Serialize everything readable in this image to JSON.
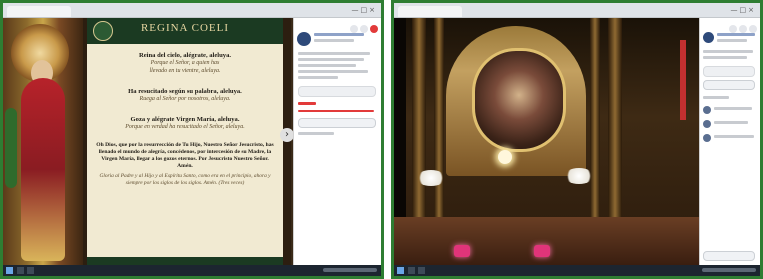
{
  "left_screen": {
    "title": "REGINA COELI",
    "verses": [
      {
        "bold": "Reina del cielo, alégrate, aleluya.",
        "italic": "Porque el Señor, a quien has\nllevado en tu vientre, aleluya."
      },
      {
        "bold": "Ha resucitado según su palabra, aleluya.",
        "italic": "Ruega al Señor por nosotros, aleluya."
      },
      {
        "bold": "Goza y alégrate Virgen María, aleluya.",
        "italic": "Porque en verdad ha resucitado el Señor, aleluya."
      },
      {
        "bold": "Oh Dios, que por la resurrección de Tu Hijo, Nuestro Señor Jesucristo, has llenado el mundo de alegría, concédenos, por intercesión de su Madre, la Virgen María, llegar a los gozos eternos. Por Jesucristo Nuestro Señor. Amén.",
        "italic": "Gloria al Padre y al Hijo y al Espíritu Santo, como era en el principio, ahora y siempre por los siglos de los siglos. Amén. (Tres veces)"
      }
    ],
    "next_glyph": "›"
  },
  "icons": {
    "next": "chevron-right-icon",
    "crest": "crest-icon",
    "monstrance": "monstrance-icon"
  },
  "colors": {
    "frame_border": "#2e7d32",
    "header_green": "#1b3a22",
    "parchment": "#f1ead2",
    "candle_pink": "#e0347a"
  }
}
